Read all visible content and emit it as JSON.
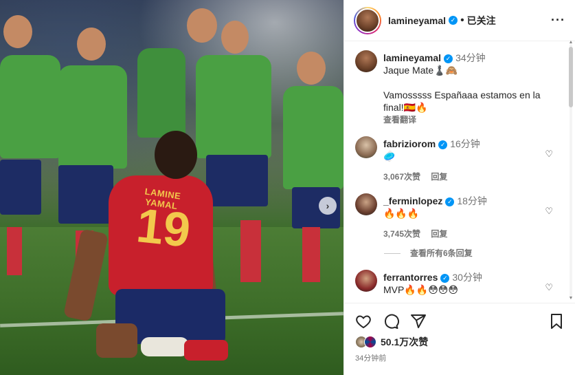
{
  "post": {
    "username": "lamineyamal",
    "follow_status": "已关注",
    "more_label": "···",
    "jersey_name": "LAMINE YAMAL",
    "jersey_number": "19"
  },
  "caption": {
    "username": "lamineyamal",
    "time": "34分钟",
    "line1": "Jaque Mate♟️🙈",
    "line2": "Vamosssss Españaaa estamos en la final!🇪🇸🔥",
    "translate": "查看翻译"
  },
  "comments": [
    {
      "username": "fabrizio",
      "username_suffix": "rom",
      "time": "16分钟",
      "text": "🥏",
      "likes": "3,067次赞",
      "reply": "回复"
    },
    {
      "username": "_fermin",
      "username_suffix": "lopez",
      "time": "18分钟",
      "text": "🔥🔥🔥",
      "likes": "3,745次赞",
      "reply": "回复"
    },
    {
      "username": "ferrantorres",
      "username_suffix": "",
      "time": "30分钟",
      "text": "MVP🔥🔥😳😳😳",
      "likes": "",
      "reply": ""
    }
  ],
  "view_replies": "查看所有6条回复",
  "footer": {
    "likes": "50.1万次赞",
    "posted": "34分钟前"
  },
  "icons": {
    "heart": "heart-icon",
    "comment": "comment-icon",
    "share": "share-icon",
    "bookmark": "bookmark-icon",
    "next": "chevron-right-icon"
  },
  "colors": {
    "verified": "#0095f6",
    "secondary_text": "#737373",
    "jersey_red": "#c8202c",
    "jersey_gold": "#f2c94c"
  }
}
